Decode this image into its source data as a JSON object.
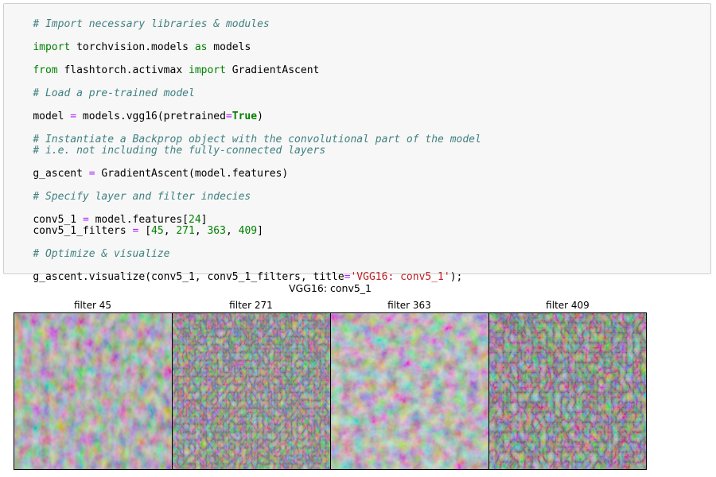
{
  "code": {
    "comment_import": "# Import necessary libraries & modules",
    "line_import_models": {
      "kw": "import",
      "rest1": " torchvision.models ",
      "kw2": "as",
      "rest2": " models"
    },
    "line_from": {
      "kw": "from",
      "mid": " flashtorch.activmax ",
      "kw2": "import",
      "rest": " GradientAscent"
    },
    "comment_load": "# Load a pre-trained model",
    "line_model": {
      "a": "model ",
      "op": "=",
      "b": " models.vgg16(pretrained",
      "op2": "=",
      "val": "True",
      "c": ")"
    },
    "comment_instantiate_1": "# Instantiate a Backprop object with the convolutional part of the model",
    "comment_instantiate_2": "# i.e. not including the fully-connected layers",
    "line_g_ascent": {
      "a": "g_ascent ",
      "op": "=",
      "b": " GradientAscent(model.features)"
    },
    "comment_specify": "# Specify layer and filter indecies",
    "line_conv5": {
      "a": "conv5_1 ",
      "op": "=",
      "b": " model.features[",
      "num": "24",
      "c": "]"
    },
    "line_filters": {
      "a": "conv5_1_filters ",
      "op": "=",
      "b": " [",
      "n1": "45",
      "s1": ", ",
      "n2": "271",
      "s2": ", ",
      "n3": "363",
      "s3": ", ",
      "n4": "409",
      "c": "]"
    },
    "comment_optimize": "# Optimize & visualize",
    "line_visualize": {
      "a": "g_ascent.visualize(conv5_1, conv5_1_filters, title",
      "op": "=",
      "str": "'VGG16: conv5_1'",
      "c": ");"
    }
  },
  "figure": {
    "suptitle": "VGG16: conv5_1",
    "panels": [
      {
        "title": "filter 45"
      },
      {
        "title": "filter 271"
      },
      {
        "title": "filter 363"
      },
      {
        "title": "filter 409"
      }
    ]
  },
  "colors": {
    "comment": "#408080",
    "keyword": "#008000",
    "operator": "#aa22ff",
    "string": "#ba2121",
    "cell_background": "#f7f7f7"
  }
}
